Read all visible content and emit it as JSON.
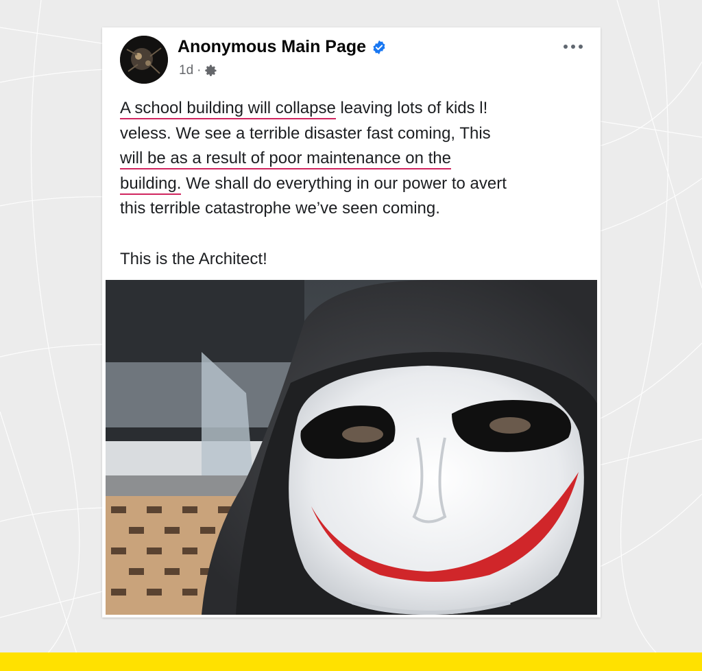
{
  "post": {
    "author": "Anonymous Main Page",
    "verified": true,
    "time": "1d",
    "separator": "·",
    "audience_icon": "gear-icon",
    "menu_icon": "more-horizontal-icon",
    "lines": {
      "l1a": "A school building will collapse",
      "l1b": " leaving lots of kids l!",
      "l2": "veless. We see a terrible disaster fast coming, This",
      "l3": "will be as a result of poor maintenance on the",
      "l4a": "building.",
      "l4b": " We shall do everything in our power to avert",
      "l5": "this terrible catastrophe we’ve seen coming."
    },
    "signoff": "This is the Architect!",
    "image_subject": "person wearing black hood and white mask with red smile"
  },
  "colors": {
    "accent_underline": "#d0245e",
    "verified_blue": "#1877f2",
    "bottom_bar": "#ffe100"
  }
}
